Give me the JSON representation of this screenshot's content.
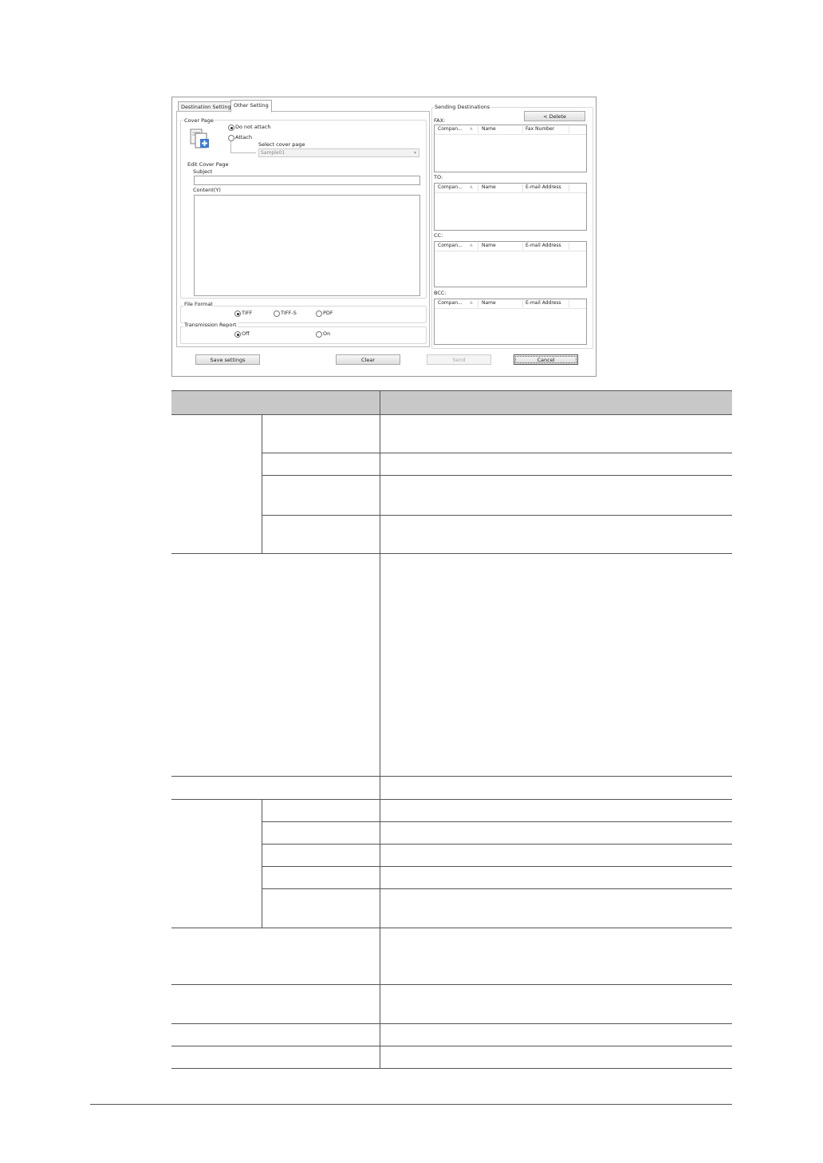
{
  "dialog": {
    "tabs": [
      "Destination Settings",
      "Other Setting"
    ],
    "cover_page": {
      "title": "Cover Page",
      "options": [
        "Do not attach",
        "Attach"
      ],
      "selected": "Do not attach",
      "select_label": "Select cover page",
      "select_value": "Sample01",
      "edit_title": "Edit Cover Page",
      "subject_label": "Subject",
      "content_label": "Content(Y)"
    },
    "file_format": {
      "title": "File Format",
      "options": [
        "TIFF",
        "TIFF-S",
        "PDF"
      ],
      "selected": "TIFF"
    },
    "transmission_report": {
      "title": "Transmission Report",
      "options": [
        "Off",
        "On"
      ],
      "selected": "Off"
    },
    "sending_destinations": {
      "title": "Sending Destinations",
      "delete_button": "< Delete",
      "lists": [
        {
          "label": "FAX:",
          "columns": [
            "Compan...",
            "Name",
            "Fax Number"
          ]
        },
        {
          "label": "TO:",
          "columns": [
            "Compan...",
            "Name",
            "E-mail Address"
          ]
        },
        {
          "label": "CC:",
          "columns": [
            "Compan...",
            "Name",
            "E-mail Address"
          ]
        },
        {
          "label": "BCC:",
          "columns": [
            "Compan...",
            "Name",
            "E-mail Address"
          ]
        }
      ]
    },
    "buttons": {
      "save": "Save settings",
      "clear": "Clear",
      "send": "Send",
      "cancel": "Cancel"
    }
  },
  "table": {
    "header": [
      "",
      ""
    ],
    "rows": []
  }
}
